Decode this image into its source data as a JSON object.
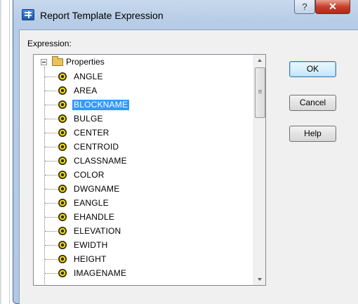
{
  "window": {
    "title": "Report Template Expression",
    "help_glyph": "?",
    "close_glyph": "✕"
  },
  "expression": {
    "label": "Expression:"
  },
  "tree": {
    "root_label": "Properties",
    "items": [
      {
        "label": "ANGLE"
      },
      {
        "label": "AREA"
      },
      {
        "label": "BLOCKNAME",
        "selected": true
      },
      {
        "label": "BULGE"
      },
      {
        "label": "CENTER"
      },
      {
        "label": "CENTROID"
      },
      {
        "label": "CLASSNAME"
      },
      {
        "label": "COLOR"
      },
      {
        "label": "DWGNAME"
      },
      {
        "label": "EANGLE"
      },
      {
        "label": "EHANDLE"
      },
      {
        "label": "ELEVATION"
      },
      {
        "label": "EWIDTH"
      },
      {
        "label": "HEIGHT"
      },
      {
        "label": "IMAGENAME"
      }
    ]
  },
  "buttons": {
    "ok": "OK",
    "cancel": "Cancel",
    "help": "Help"
  }
}
